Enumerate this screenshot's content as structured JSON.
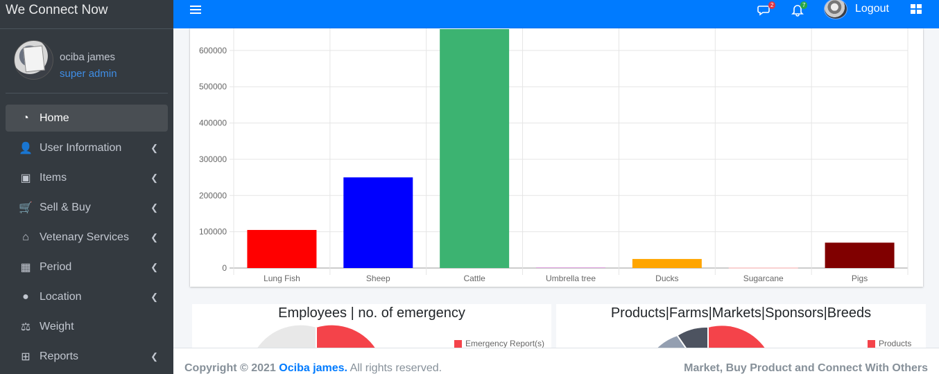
{
  "brand": "We Connect Now",
  "user": {
    "name": "ociba james",
    "role": "super admin"
  },
  "nav": [
    {
      "label": "Home",
      "icon": "tachometer-icon",
      "glyph": "◔",
      "active": true,
      "chevron": false
    },
    {
      "label": "User Information",
      "icon": "user-icon",
      "glyph": "👤",
      "active": false,
      "chevron": true
    },
    {
      "label": "Items",
      "icon": "object-group-icon",
      "glyph": "▣",
      "active": false,
      "chevron": true
    },
    {
      "label": "Sell & Buy",
      "icon": "cart-icon",
      "glyph": "🛒",
      "active": false,
      "chevron": true
    },
    {
      "label": "Vetenary Services",
      "icon": "home-icon",
      "glyph": "⌂",
      "active": false,
      "chevron": true
    },
    {
      "label": "Period",
      "icon": "calendar-icon",
      "glyph": "▦",
      "active": false,
      "chevron": true
    },
    {
      "label": "Location",
      "icon": "map-marker-icon",
      "glyph": "●",
      "active": false,
      "chevron": true
    },
    {
      "label": "Weight",
      "icon": "balance-scale-icon",
      "glyph": "⚖",
      "active": false,
      "chevron": false
    },
    {
      "label": "Reports",
      "icon": "medkit-icon",
      "glyph": "⊞",
      "active": false,
      "chevron": true
    }
  ],
  "topbar": {
    "messages_badge": "2",
    "notifications_badge": "7",
    "logout": "Logout"
  },
  "chart_data": {
    "type": "bar",
    "categories": [
      "Lung Fish",
      "Sheep",
      "Cattle",
      "Umbrella tree",
      "Ducks",
      "Sugarcane",
      "Pigs"
    ],
    "values": [
      105000,
      250000,
      680000,
      2000,
      25000,
      1000,
      70000
    ],
    "colors": [
      "#ff0000",
      "#0000ff",
      "#3cb371",
      "#dda0dd",
      "#ffa500",
      "#f4a6a6",
      "#800000"
    ],
    "ylim": [
      0,
      680000
    ],
    "yticks": [
      0,
      100000,
      200000,
      300000,
      400000,
      500000,
      600000
    ],
    "grid": true
  },
  "pies": [
    {
      "title": "Employees | no. of emergency",
      "legend": "Emergency Report(s)",
      "legend_color": "#f4434a"
    },
    {
      "title": "Products|Farms|Markets|Sponsors|Breeds",
      "legend": "Products",
      "legend_color": "#f4434a"
    }
  ],
  "footer": {
    "copyright": "Copyright © 2021",
    "author": "Ociba james.",
    "rights": "All rights reserved.",
    "tagline": "Market, Buy Product and Connect With Others"
  }
}
